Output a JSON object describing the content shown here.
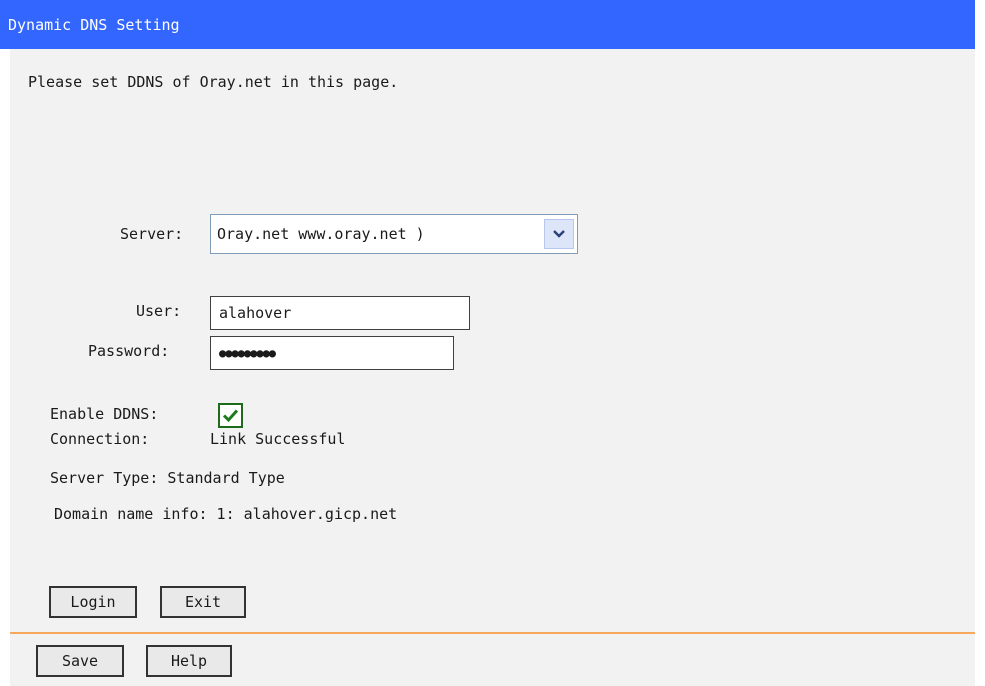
{
  "header": {
    "title": "Dynamic DNS Setting"
  },
  "intro": {
    "text": "Please set DDNS of Oray.net in this page."
  },
  "form": {
    "server_label": "Server:",
    "server_value": "Oray.net    www.oray.net )",
    "user_label": "User:",
    "user_value": "alahover",
    "password_label": "Password:",
    "password_mask": "●●●●●●●●●",
    "enable_label": "Enable DDNS:",
    "enable_checked": true
  },
  "status": {
    "connection_label": "Connection:",
    "connection_value": "Link Successful",
    "server_type": "Server Type: Standard Type",
    "domain_info": "Domain name info:  1: alahover.gicp.net"
  },
  "buttons": {
    "login": "Login",
    "exit": "Exit"
  },
  "footer": {
    "save": "Save",
    "help": "Help"
  },
  "colors": {
    "title_bar": "#3366ff",
    "panel": "#f2f2f2",
    "separator": "#f7a85c",
    "check": "#1e7a1e"
  }
}
